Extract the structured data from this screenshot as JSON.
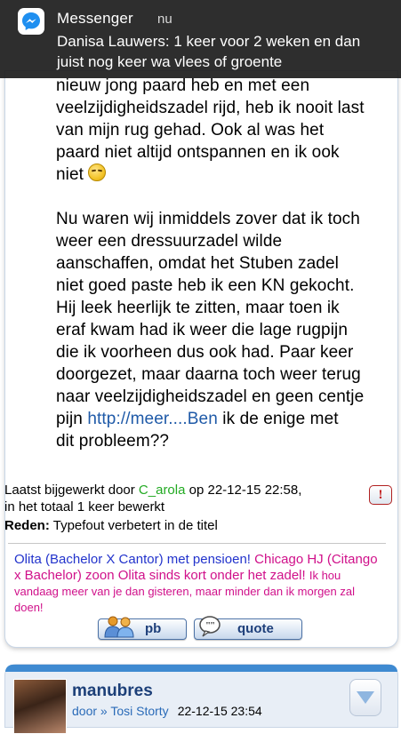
{
  "notification": {
    "app": "Messenger",
    "time": "nu",
    "message": "Danisa Lauwers: 1 keer voor 2 weken en dan juist nog keer wa vlees of groente"
  },
  "post": {
    "lines_p1": [
      "nieuw jong paard heb en met een",
      "veelzijdigheidszadel rijd, heb ik nooit last",
      "van mijn rug gehad. Ook al was het",
      "paard niet altijd ontspannen en ik ook"
    ],
    "p1_last": "niet",
    "emoji": "relieved-face-emoji",
    "lines_p2": [
      "Nu waren wij inmiddels zover dat ik toch",
      "weer een dressuurzadel wilde",
      "aanschaffen, omdat het Stuben zadel",
      "niet goed paste heb ik een KN gekocht.",
      "Hij leek heerlijk te zitten, maar toen ik",
      "eraf kwam had ik weer die lage rugpijn",
      "die ik voorheen dus ook had. Paar keer",
      "doorgezet, maar daarna toch weer terug",
      "naar veelzijdigheidszadel en geen centje"
    ],
    "p2_pre_link": "pijn",
    "link": "http://meer....Ben",
    "p2_post_link": "ik de enige met",
    "p2_last": "dit probleem??"
  },
  "edit_info": {
    "prefix": "Laatst bijgewerkt door",
    "user": "C_arola",
    "suffix": "op 22-12-15 22:58,",
    "line2": "in het totaal 1 keer bewerkt",
    "reason_label": "Reden:",
    "reason_text": "Typefout verbetert in de titel",
    "report_label": "!"
  },
  "signature": {
    "blue1": "Olita (Bachelor X Cantor) met pensioen!",
    "magenta1": "Chicago HJ (Citango x Bachelor) zoon Olita sinds kort onder het zadel!",
    "small": "Ik hou vandaag meer van je dan gisteren, maar minder dan ik morgen zal doen!"
  },
  "actions": {
    "pb_label": "pb",
    "quote_label": "quote"
  },
  "next_post": {
    "username": "manubres",
    "meta": "door » Tosi Storty",
    "date": "22-12-15 23:54"
  },
  "colors": {
    "notification_bg": "#1e1e1e",
    "link_blue": "#1f5aa8",
    "username_green": "#22aa22",
    "signature_blue": "#2233cc",
    "signature_magenta": "#d0108a",
    "header_blue": "#3f8ad1"
  }
}
